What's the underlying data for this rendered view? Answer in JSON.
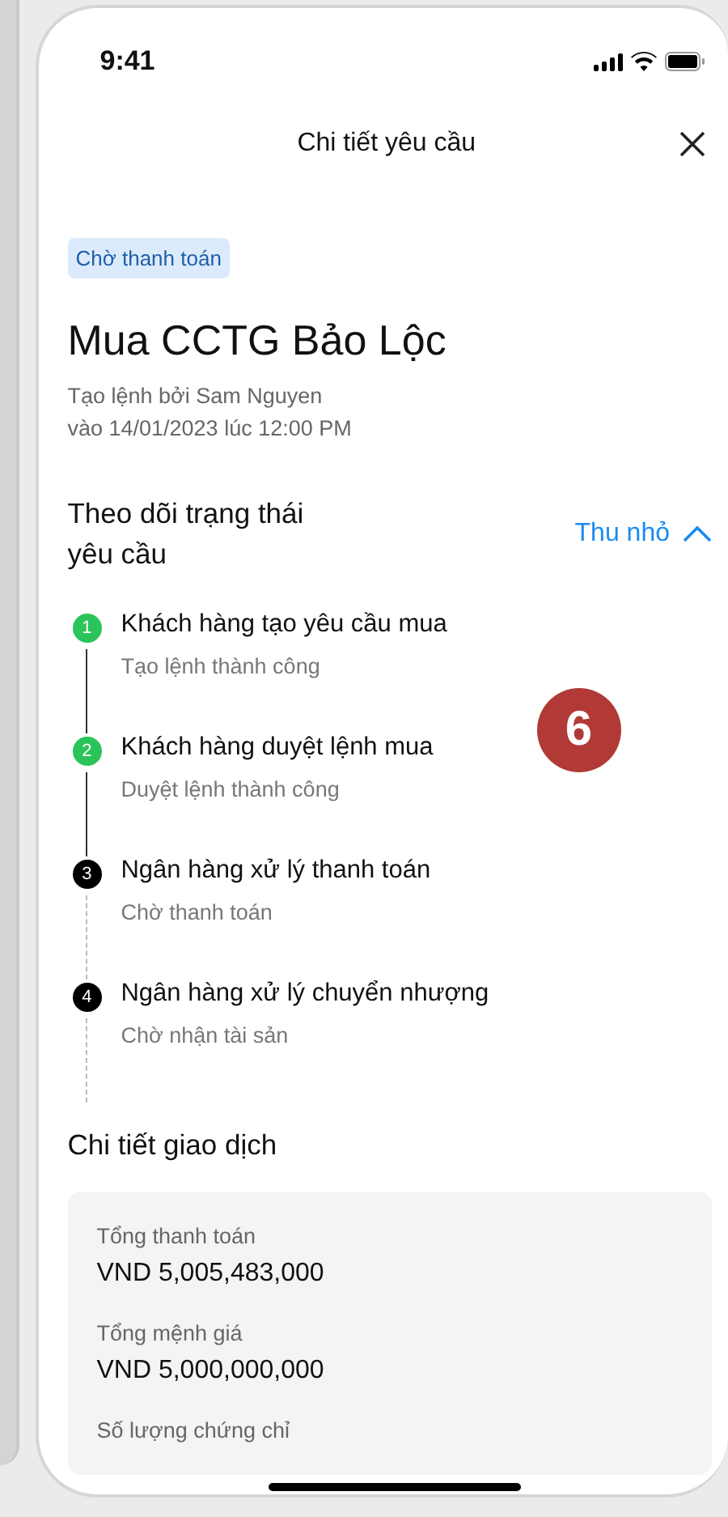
{
  "status_bar": {
    "time": "9:41"
  },
  "header": {
    "title": "Chi tiết yêu cầu"
  },
  "status_tag": "Chờ thanh toán",
  "order": {
    "title": "Mua CCTG Bảo Lộc",
    "created_by": "Tạo lệnh bởi Sam Nguyen",
    "created_at": "vào 14/01/2023 lúc 12:00 PM"
  },
  "tracking": {
    "title": "Theo dõi trạng thái yêu cầu",
    "toggle": "Thu nhỏ",
    "expanded": true,
    "steps": [
      {
        "number": "1",
        "title": "Khách hàng tạo yêu cầu mua",
        "subtitle": "Tạo lệnh thành công",
        "done": true
      },
      {
        "number": "2",
        "title": "Khách hàng duyệt lệnh mua",
        "subtitle": "Duyệt lệnh thành công",
        "done": true
      },
      {
        "number": "3",
        "title": "Ngân hàng xử lý thanh toán",
        "subtitle": "Chờ thanh toán",
        "done": false
      },
      {
        "number": "4",
        "title": "Ngân hàng xử lý chuyển nhượng",
        "subtitle": "Chờ nhận tài sản",
        "done": false
      }
    ]
  },
  "annotation_badge": "6",
  "transaction": {
    "title": "Chi tiết giao dịch",
    "fields": [
      {
        "label": "Tổng thanh toán",
        "value": "VND 5,005,483,000"
      },
      {
        "label": "Tổng mệnh giá",
        "value": "VND 5,000,000,000"
      },
      {
        "label": "Số lượng chứng chỉ"
      }
    ]
  }
}
